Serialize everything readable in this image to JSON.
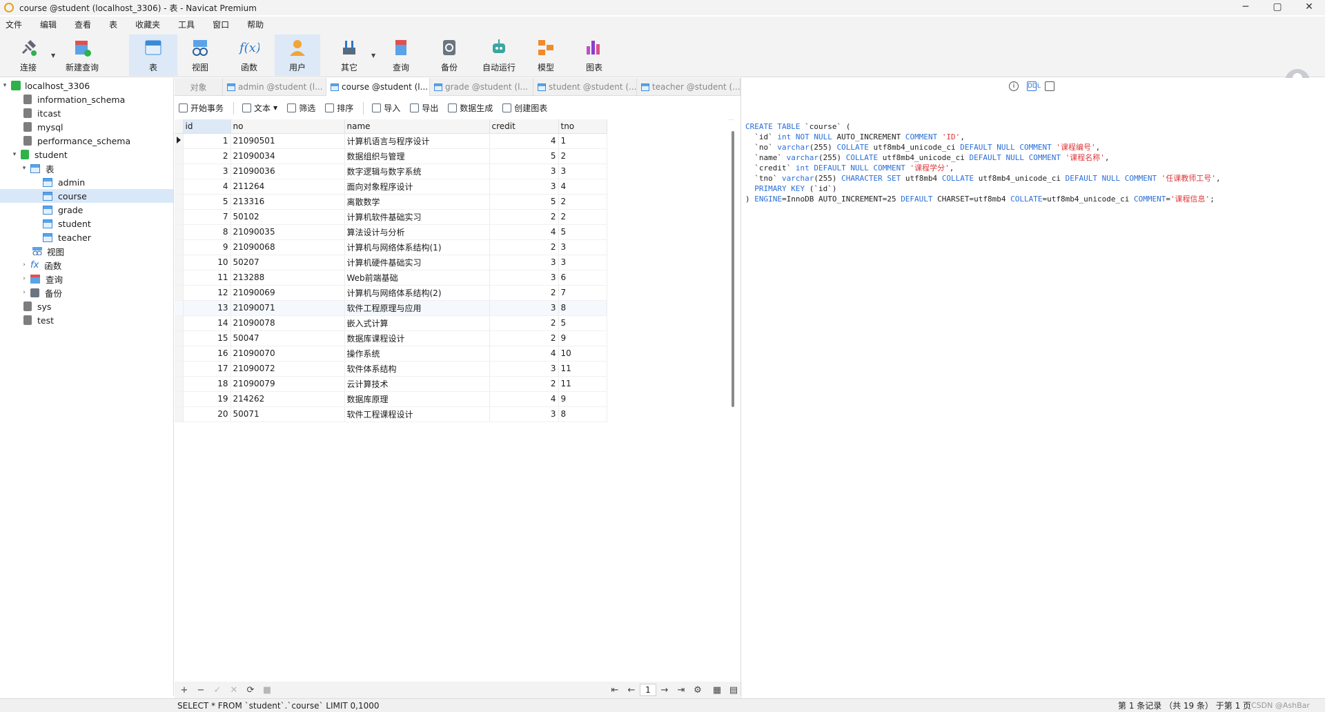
{
  "window": {
    "title": "course @student (localhost_3306) - 表 - Navicat Premium",
    "controls": [
      "─",
      "▢",
      "✕"
    ]
  },
  "menu": [
    "文件",
    "编辑",
    "查看",
    "表",
    "收藏夹",
    "工具",
    "窗口",
    "帮助"
  ],
  "toolbar": {
    "connect": "连接",
    "new_query": "新建查询",
    "table": "表",
    "view": "视图",
    "function": "函数",
    "user": "用户",
    "other": "其它",
    "query": "查询",
    "backup": "备份",
    "auto_run": "自动运行",
    "model": "模型",
    "chart": "图表"
  },
  "tree": {
    "connection": "localhost_3306",
    "databases": [
      "information_schema",
      "itcast",
      "mysql",
      "performance_schema",
      "student"
    ],
    "student_groups": {
      "tables": "表",
      "views": "视图",
      "functions": "函数",
      "queries": "查询",
      "backups": "备份"
    },
    "tables": [
      "admin",
      "course",
      "grade",
      "student",
      "teacher"
    ],
    "other_databases": [
      "sys",
      "test"
    ]
  },
  "tabs": [
    "对象",
    "admin @student (l...",
    "course @student (l...",
    "grade @student (l...",
    "student @student (...",
    "teacher @student (..."
  ],
  "subtoolbar": {
    "begin_tx": "开始事务",
    "text": "文本",
    "filter": "筛选",
    "sort": "排序",
    "import": "导入",
    "export": "导出",
    "data_gen": "数据生成",
    "create_chart": "创建图表"
  },
  "grid": {
    "columns": [
      "id",
      "no",
      "name",
      "credit",
      "tno"
    ],
    "rows": [
      [
        "1",
        "21090501",
        "计算机语言与程序设计",
        "4",
        "1"
      ],
      [
        "2",
        "21090034",
        "数据组织与管理",
        "5",
        "2"
      ],
      [
        "3",
        "21090036",
        "数字逻辑与数字系统",
        "3",
        "3"
      ],
      [
        "4",
        "211264",
        "面向对象程序设计",
        "3",
        "4"
      ],
      [
        "5",
        "213316",
        "离散数学",
        "5",
        "2"
      ],
      [
        "7",
        "50102",
        "计算机软件基础实习",
        "2",
        "2"
      ],
      [
        "8",
        "21090035",
        "算法设计与分析",
        "4",
        "5"
      ],
      [
        "9",
        "21090068",
        "计算机与网络体系结构(1)",
        "2",
        "3"
      ],
      [
        "10",
        "50207",
        "计算机硬件基础实习",
        "3",
        "3"
      ],
      [
        "11",
        "213288",
        "Web前端基础",
        "3",
        "6"
      ],
      [
        "12",
        "21090069",
        "计算机与网络体系结构(2)",
        "2",
        "7"
      ],
      [
        "13",
        "21090071",
        "软件工程原理与应用",
        "3",
        "8"
      ],
      [
        "14",
        "21090078",
        "嵌入式计算",
        "2",
        "5"
      ],
      [
        "15",
        "50047",
        "数据库课程设计",
        "2",
        "9"
      ],
      [
        "16",
        "21090070",
        "操作系统",
        "4",
        "10"
      ],
      [
        "17",
        "21090072",
        "软件体系结构",
        "3",
        "11"
      ],
      [
        "18",
        "21090079",
        "云计算技术",
        "2",
        "11"
      ],
      [
        "19",
        "214262",
        "数据库原理",
        "4",
        "9"
      ],
      [
        "20",
        "50071",
        "软件工程课程设计",
        "3",
        "8"
      ]
    ]
  },
  "bottom_nav": {
    "add": "+",
    "remove": "−",
    "confirm": "✓",
    "cancel": "✕",
    "refresh": "⟳",
    "stop": "■",
    "first": "⇤",
    "prev": "←",
    "page": "1",
    "next": "→",
    "last": "⇥",
    "settings": "⚙"
  },
  "ddl": [
    "CREATE TABLE `course` (",
    "  `id` int NOT NULL AUTO_INCREMENT COMMENT 'ID',",
    "  `no` varchar(255) COLLATE utf8mb4_unicode_ci DEFAULT NULL COMMENT '课程编号',",
    "  `name` varchar(255) COLLATE utf8mb4_unicode_ci DEFAULT NULL COMMENT '课程名称',",
    "  `credit` int DEFAULT NULL COMMENT '课程学分',",
    "  `tno` varchar(255) CHARACTER SET utf8mb4 COLLATE utf8mb4_unicode_ci DEFAULT NULL COMMENT '任课教师工号',",
    "  PRIMARY KEY (`id`)",
    ") ENGINE=InnoDB AUTO_INCREMENT=25 DEFAULT CHARSET=utf8mb4 COLLATE=utf8mb4_unicode_ci COMMENT='课程信息';"
  ],
  "status": {
    "sql": "SELECT * FROM `student`.`course` LIMIT 0,1000",
    "records": "第 1 条记录 （共 19 条） 于第 1 页",
    "watermark": "CSDN @AshBar"
  }
}
